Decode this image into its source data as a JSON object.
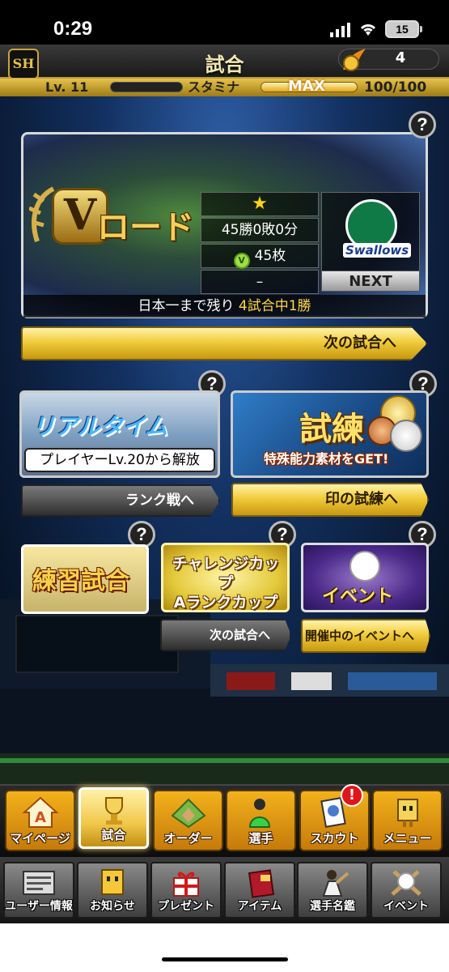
{
  "status_bar": {
    "time": "0:29",
    "battery": "15"
  },
  "header": {
    "logo": "SH",
    "title": "試合",
    "coin_count": "4"
  },
  "level_bar": {
    "level": "Lv. 11",
    "stamina_label": "スタミナ",
    "stamina_max": "MAX",
    "stamina_value": "100/100",
    "stamina_fill": 1.0
  },
  "vroad": {
    "badge": "V",
    "title": "ロード",
    "star": "★",
    "record": "45勝0敗0分",
    "medals": "45枚",
    "medal_icon": "V",
    "dash": "–",
    "team_name": "Swallows",
    "next_label": "NEXT",
    "remaining_prefix": "日本一まで残り ",
    "remaining_accent": "4試合中1勝",
    "next_match_button": "次の試合へ"
  },
  "modes": {
    "realtime_title": "リアルタイム",
    "realtime_lock": "プレイヤーLv.20から解放",
    "rank_button": "ランク戦へ",
    "trial_title": "試練",
    "trial_subtitle": "特殊能力素材をGET!",
    "trial_button": "印の試練へ",
    "practice_title": "練習試合",
    "challenge_title_1": "チャレンジカップ",
    "challenge_title_2": "Aランクカップ",
    "challenge_button": "次の試合へ",
    "event_title": "イベント",
    "event_button": "開催中のイベントへ"
  },
  "help_glyph": "?",
  "nav_main": [
    {
      "label": "マイページ",
      "icon": "home-icon"
    },
    {
      "label": "試合",
      "icon": "trophy-icon"
    },
    {
      "label": "オーダー",
      "icon": "field-icon"
    },
    {
      "label": "選手",
      "icon": "player-icon"
    },
    {
      "label": "スカウト",
      "icon": "scout-icon"
    },
    {
      "label": "メニュー",
      "icon": "menu-icon"
    }
  ],
  "nav_scout_badge": "!",
  "nav_sub": [
    {
      "label": "ユーザー情報",
      "icon": "user-info-icon"
    },
    {
      "label": "お知らせ",
      "icon": "notice-icon"
    },
    {
      "label": "プレゼント",
      "icon": "gift-icon"
    },
    {
      "label": "アイテム",
      "icon": "item-icon"
    },
    {
      "label": "選手名鑑",
      "icon": "player-book-icon"
    },
    {
      "label": "イベント",
      "icon": "event-icon"
    }
  ],
  "colors": {
    "gold": "#f1cc3c",
    "accent_yellow": "#ffd84a",
    "badge_red": "#e2141a"
  }
}
